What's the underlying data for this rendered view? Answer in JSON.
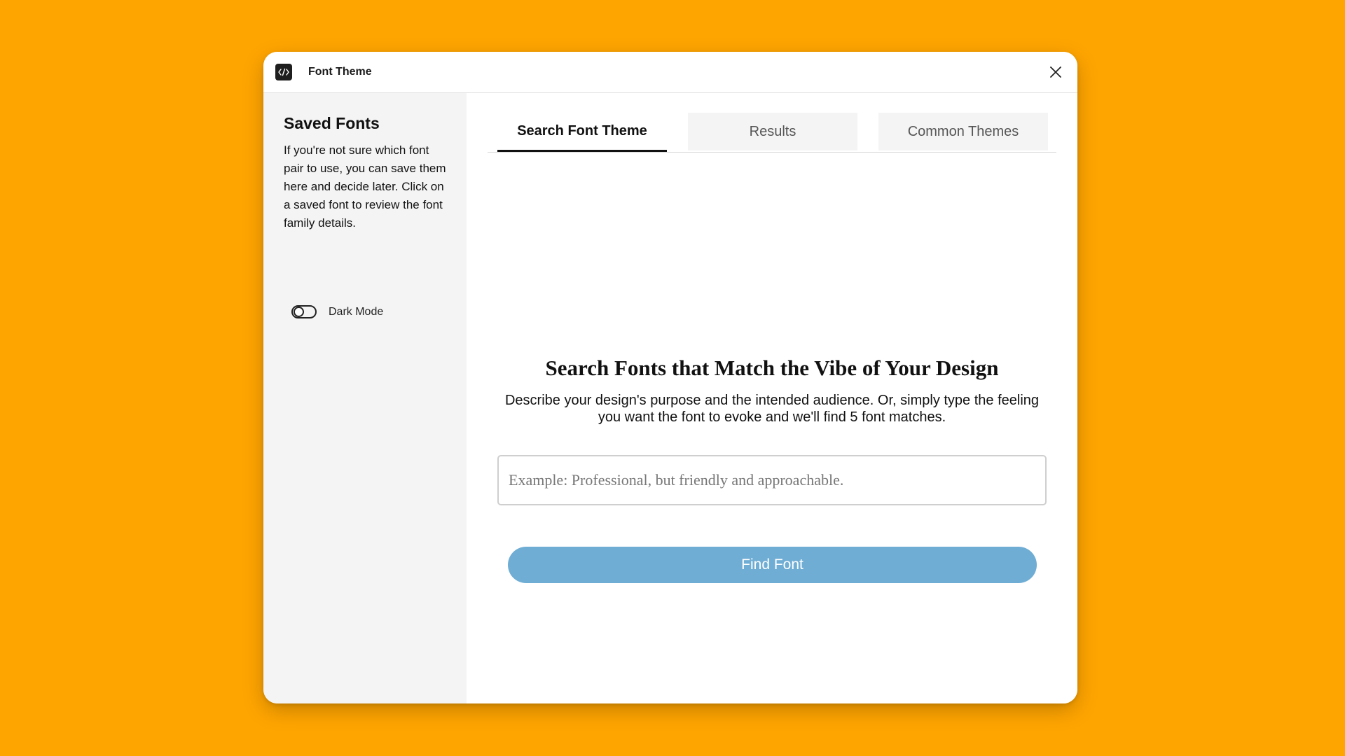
{
  "window": {
    "title": "Font Theme",
    "app_icon": "code-icon",
    "close_icon": "close-icon"
  },
  "sidebar": {
    "title": "Saved Fonts",
    "description": "If you're not sure which font pair to use, you can save them here and decide later. Click on a saved font to review the font family details.",
    "dark_mode": {
      "label": "Dark Mode",
      "enabled": false
    }
  },
  "tabs": [
    {
      "label": "Search Font Theme",
      "active": true
    },
    {
      "label": "Results",
      "active": false
    },
    {
      "label": "Common Themes",
      "active": false
    }
  ],
  "search": {
    "heading": "Search Fonts that Match the Vibe of Your Design",
    "description": "Describe your design's purpose and the intended audience. Or, simply type the feeling you want the font to evoke and we'll find 5 font matches.",
    "placeholder": "Example: Professional, but friendly and approachable.",
    "value": "",
    "button_label": "Find Font"
  },
  "colors": {
    "background": "#FFA500",
    "button": "#6fadd4",
    "sidebar": "#f4f4f4"
  }
}
